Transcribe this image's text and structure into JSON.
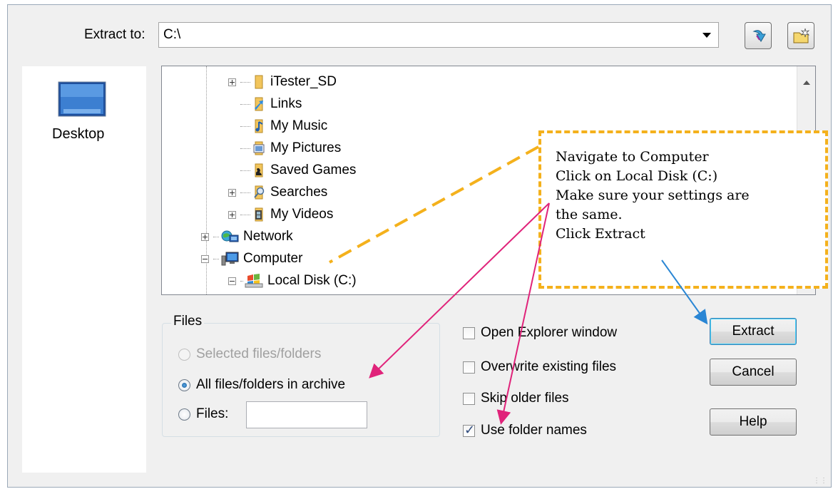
{
  "header": {
    "extract_to_label": "Extract to:",
    "path_value": "C:\\"
  },
  "places": {
    "desktop_label": "Desktop"
  },
  "tree": {
    "items": [
      {
        "label": "iTester_SD",
        "icon": "folder-icon"
      },
      {
        "label": "Links",
        "icon": "links-folder-icon"
      },
      {
        "label": "My Music",
        "icon": "music-folder-icon"
      },
      {
        "label": "My Pictures",
        "icon": "pictures-folder-icon"
      },
      {
        "label": "Saved Games",
        "icon": "saved-games-folder-icon"
      },
      {
        "label": "Searches",
        "icon": "searches-folder-icon"
      },
      {
        "label": "My Videos",
        "icon": "videos-folder-icon"
      },
      {
        "label": "Network",
        "icon": "network-icon"
      },
      {
        "label": "Computer",
        "icon": "computer-icon"
      },
      {
        "label": "Local Disk (C:)",
        "icon": "local-disk-icon"
      }
    ]
  },
  "files_group": {
    "title": "Files",
    "option_selected": "Selected files/folders",
    "option_all": "All files/folders in archive",
    "option_files": "Files:",
    "files_value": ""
  },
  "options": {
    "open_explorer": "Open Explorer window",
    "overwrite": "Overwrite existing files",
    "skip_older": "Skip older files",
    "use_folder_names": "Use folder names"
  },
  "buttons": {
    "extract": "Extract",
    "cancel": "Cancel",
    "help": "Help"
  },
  "callout": {
    "line1": "Navigate to Computer",
    "line2": "Click on Local Disk (C:)",
    "line3": "Make sure your settings are",
    "line4": "the same.",
    "line5": "Click Extract"
  },
  "colors": {
    "callout_border": "#f4b11c",
    "arrow_pink": "#e0237a",
    "arrow_blue": "#2a86d4"
  }
}
